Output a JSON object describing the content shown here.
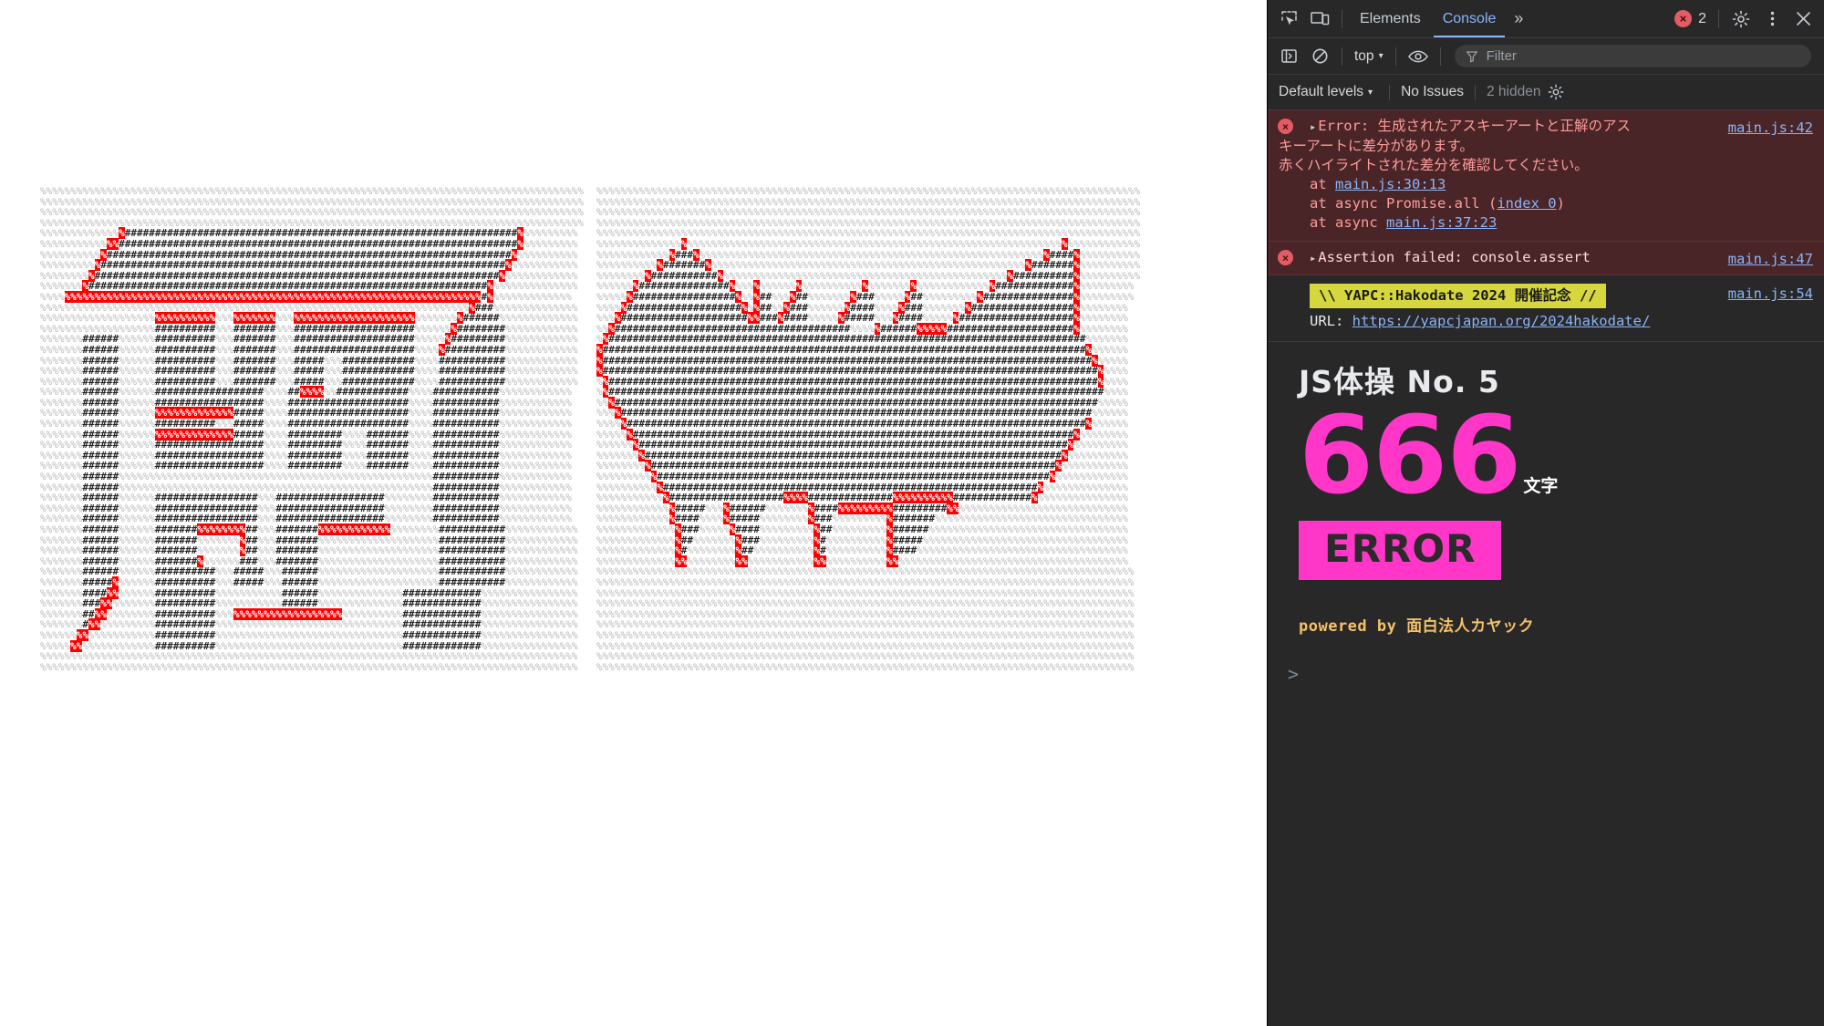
{
  "devtools": {
    "tabbar": {
      "inspect_icon": "inspect-element-icon",
      "device_icon": "device-toolbar-icon",
      "tabs": [
        {
          "label": "Elements",
          "active": false
        },
        {
          "label": "Console",
          "active": true
        }
      ],
      "more_tabs": "»",
      "error_count": "2",
      "error_badge_glyph": "×",
      "settings_icon": "gear-icon",
      "more_icon": "kebab-menu-icon",
      "close_icon": "close-icon"
    },
    "filterbar": {
      "sidebar_icon": "console-sidebar-icon",
      "clear_icon": "clear-console-icon",
      "context_label": "top",
      "context_caret": "▾",
      "eye_icon": "live-expression-icon",
      "filter_icon": "filter-funnel-icon",
      "filter_placeholder": "Filter",
      "filter_value": ""
    },
    "levelsbar": {
      "levels_label": "Default levels",
      "levels_caret": "▾",
      "issues_label": "No Issues",
      "hidden_label": "2 hidden",
      "settings_icon": "console-settings-gear-icon"
    },
    "messages": [
      {
        "type": "error",
        "icon": "error-circle-icon",
        "disclosure": "▸",
        "text_line1": "Error: 生成されたアスキーアートと正解のアス",
        "text_line2": "キーアートに差分があります。",
        "text_line3": "赤くハイライトされた差分を確認してください。",
        "source": "main.js:42",
        "stack": [
          {
            "prefix": "at ",
            "link": "main.js:30:13",
            "suffix": ""
          },
          {
            "prefix": "at async Promise.all (",
            "link": "index 0",
            "suffix": ")"
          },
          {
            "prefix": "at async ",
            "link": "main.js:37:23",
            "suffix": ""
          }
        ]
      },
      {
        "type": "assert",
        "icon": "error-circle-icon",
        "disclosure": "▸",
        "text": "Assertion failed: console.assert",
        "source": "main.js:47"
      },
      {
        "type": "plain",
        "banner": "\\\\ YAPC::Hakodate 2024 開催記念 //",
        "url_label": "URL: ",
        "url": "https://yapcjapan.org/2024hakodate/",
        "source": "main.js:54"
      }
    ],
    "hero": {
      "title": "JS体操 No. 5",
      "count": "666",
      "unit": "文字",
      "badge": "ERROR",
      "powered_by": "powered by 面白法人カヤック"
    },
    "prompt_glyph": ">"
  },
  "colors": {
    "accent_pink": "#ff36c8",
    "banner_yellow": "#d6d63f",
    "error_bg": "#4a2527",
    "link_blue": "#8ab4f8",
    "diff_red": "#ff0000",
    "devtools_bg": "#282828",
    "powered_orange": "#f5c06a"
  },
  "page": {
    "panels": [
      {
        "name": "generated-ascii-art",
        "rows": [
          "%%%%%%%%%%%%%%%%%%%%%%%%%%%%%%%%%%%%%%%%%%%%%%%%%%%%%%%%%%%%%%%%%%%%%%%%%%%%%%%%%%%%%%%%%%",
          "%%%%%%%%%%%%%%%%%%%%%%%%%%%%%%%%%%%%%%%%%%%%%%%%%%%%%%%%%%%%%%%%%%%%%%%%%%%%%%%%%%%%%%%%%%",
          "%%%%%%%%%%%%%%%%%%%%%%%%%%%%%%%%%%%%%%%%%%%%%%%%%%%%%%%%%%%%%%%%%%%%%%%%%%%%%%%%%%%%%%%%%%",
          "%%%%%%%%%%%%%%%%%%%%%%%%%%%%%%%%%%%%%%%%%%%%%%%%%%%%%%%%%%%%%%%%%%%%%%%%%%%%%%%%%%%%%%%%%%",
          "%%%%%%%%%%%%%R#################################################################R%%%%%%%%%",
          "%%%%%%%%%%%RR##################################################################R%%%%%%%%%",
          "%%%%%%%%%%R###################################################################R%%%%%%%%%%",
          "%%%%%%%%%R###################################################################R%%%%%%%%%%%",
          "%%%%%%%%R###################################################################R%%%%%%%%%%%%",
          "%%%%%%%R##################################################################R%%%%%%%%%%%%%%",
          "%%%%RRRRRRRRRRRRRRRRRRRRRRRRRRRRRRRRRRRRRRRRRRRRRRRRRRRRRRRRRRRRRRRRRRRRR#R%%%%%%%%%%%%%",
          "%%%%%%%%%%%%%%%%%%%%%%%%%%%%%%%%%%%%%%%%%%%%%%%%%%%%%%%%%%%%%%%%%%%%%%%R###%%%%%%%%%%%%%%",
          "%%%%%%%%%%%%%%%%%%%RRRRRRRRRR%%%RRRRRRR%%%RRRRRRRRRRRRRRRRRRRR%%%%%%%R######%%%%%%%%%%%%%",
          "%%%%%%%%%%%%%%%%%%%##########%%%#######%%%####################%%%%%%R########%%%%%%%%%%%%",
          "%%%%%%%######%%%%%%##########%%%#######%%%####################%%%%%R#########%%%%%%%%%%%%",
          "%%%%%%%######%%%%%%##########%%%#######%%%####################%%%%R##########%%%%%%%%%%%%",
          "%%%%%%%######%%%%%%##########%%%#######%%%#####%%%############%%%%###########%%%%%%%%%%%%",
          "%%%%%%%######%%%%%%##########%%%#######%%%#####%%%############%%%%###########%%%%%%%%%%%%",
          "%%%%%%%######%%%%%%##########%%%#######%%%#####%%%############%%%%###########%%%%%%%%%%%%",
          "%%%%%%%######%%%%%%##################%%%%##RRRR%%############%%%%###########%%%%%%%%%%%%",
          "%%%%%%%######%%%%%%##################%%%%####################%%%%###########%%%%%%%%%%%%",
          "%%%%%%%######%%%%%%RRRRRRRRRRRRR#####%%%%####################%%%%###########%%%%%%%%%%%%",
          "%%%%%%%######%%%%%%##########%%%#####%%%%####################%%%%###########%%%%%%%%%%%%",
          "%%%%%%%######%%%%%%RRRRRRRRRRRRR#####%%%%#########%%%%#######%%%%###########%%%%%%%%%%%%",
          "%%%%%%%######%%%%%%##################%%%%#########%%%%#######%%%%###########%%%%%%%%%%%%",
          "%%%%%%%######%%%%%%##################%%%%#########%%%%#######%%%%###########%%%%%%%%%%%%",
          "%%%%%%%######%%%%%%##################%%%%#########%%%%#######%%%%###########%%%%%%%%%%%%",
          "%%%%%%%######%%%%%%%%%%%%%%%%%%%%%%%%%%%%%%%%%%%%%%%%%%%%%%%%%%%%###########%%%%%%%%%%%%",
          "%%%%%%%######%%%%%%%%%%%%%%%%%%%%%%%%%%%%%%%%%%%%%%%%%%%%%%%%%%%%###########%%%%%%%%%%%%",
          "%%%%%%%######%%%%%%#################%%%##################%%%%%%%%###########%%%%%%%%%%%%",
          "%%%%%%%######%%%%%%#################%%%##################%%%%%%%%###########%%%%%%%%%%%%",
          "%%%%%%%######%%%%%%#################%%%##################%%%%%%%%###########%%%%%%%%%%%%",
          "%%%%%%%######%%%%%%#######RRRRRRRR##%%%#######RRRRRRRRRRRR%%%%%%%%###########%%%%%%%%%%%%",
          "%%%%%%%######%%%%%%#######%%%%%%%R##%%%#######%%%%%%%%%%%%%%%%%%%%###########%%%%%%%%%%%%",
          "%%%%%%%######%%%%%%#######%%%%%%%R##%%%#######%%%%%%%%%%%%%%%%%%%%###########%%%%%%%%%%%%",
          "%%%%%%%######%%%%%%#######R%%%%%%###%%%#######%%%%%%%%%%%%%%%%%%%%###########%%%%%%%%%%%%",
          "%%%%%%%######%%%%%%##########%%%#####%%%######%%%%%%%%%%%%%%%%%%%%###########%%%%%%%%%%%%",
          "%%%%%%%#####R%%%%%%##########%%%#####%%%######%%%%%%%%%%%%%%%%%%%%###########%%%%%%%%%%%%",
          "%%%%%%%####RR%%%%%%##########%%%%%%%%%%%######%%%%%%%%%%%%%%#############%%%%%%%%%%%%%%%%",
          "%%%%%%%###RR%%%%%%%##########%%%%%%%%%%%######%%%%%%%%%%%%%%#############%%%%%%%%%%%%%%%%",
          "%%%%%%%##RR%%%%%%%%##########%%%RRRRRRRRRRRRRRRRRR%%%%%%%%%%#############%%%%%%%%%%%%%%%%",
          "%%%%%%%#RR%%%%%%%%%##########%%%%%%%%%%%%%%%%%%%%%%%%%%%%%%%#############%%%%%%%%%%%%%%%%",
          "%%%%%%RR%%%%%%%%%%%##########%%%%%%%%%%%%%%%%%%%%%%%%%%%%%%%#############%%%%%%%%%%%%%%%%",
          "%%%%%RR%%%%%%%%%%%%##########%%%%%%%%%%%%%%%%%%%%%%%%%%%%%%%#############%%%%%%%%%%%%%%%%",
          "%%%%%%%%%%%%%%%%%%%%%%%%%%%%%%%%%%%%%%%%%%%%%%%%%%%%%%%%%%%%%%%%%%%%%%%%%%%%%%%%%%%%%%%%%",
          "%%%%%%%%%%%%%%%%%%%%%%%%%%%%%%%%%%%%%%%%%%%%%%%%%%%%%%%%%%%%%%%%%%%%%%%%%%%%%%%%%%%%%%%%%"
        ]
      },
      {
        "name": "expected-ascii-art",
        "rows": [
          "%%%%%%%%%%%%%%%%%%%%%%%%%%%%%%%%%%%%%%%%%%%%%%%%%%%%%%%%%%%%%%%%%%%%%%%%%%%%%%%%%%%%%%%%%%",
          "%%%%%%%%%%%%%%%%%%%%%%%%%%%%%%%%%%%%%%%%%%%%%%%%%%%%%%%%%%%%%%%%%%%%%%%%%%%%%%%%%%%%%%%%%%",
          "%%%%%%%%%%%%%%%%%%%%%%%%%%%%%%%%%%%%%%%%%%%%%%%%%%%%%%%%%%%%%%%%%%%%%%%%%%%%%%%%%%%%%%%%%%",
          "%%%%%%%%%%%%%%%%%%%%%%%%%%%%%%%%%%%%%%%%%%%%%%%%%%%%%%%%%%%%%%%%%%%%%%%%%%%%%%%%%%%%%%%%%%",
          "%%%%%%%%%%%%%%%%%%%%%%%%%%%%%%%%%%%%%%%%%%%%%%%%%%%%%%%%%%%%%%%%%%%%%%%%%%%%%%%%%%%%%%%%%%",
          "%%%%%%%%%%%%%%R%%%%%%%%%%%%%%%%%%%%%%%%%%%%%%%%%%%%%%%%%%%%%%%%%%%%%%%%%%%%%%R%%%%%%%%%%%%",
          "%%%%%%%%%%%%R###R%%%%%%%%%%%%%%%%%%%%%%%%%%%%%%%%%%%%%%%%%%%%%%%%%%%%%%%%%R####R%%%%%%%%%%",
          "%%%%%%%%%%R#######R%%%%%%%%%%%%%%%%%%%%%%%%%%%%%%%%%%%%%%%%%%%%%%%%%%%%R#######R%%%%%%%%%%",
          "%%%%%%%%R###########R%%%%%%%%%%%%%%%%%%%%%%%%%%%%%%%%%%%%%%%%%%%%%%%R##########R%%%%%%%%%%",
          "%%%%%%R###############R%%%R%%%%%%R%%%%%%%%%%R%%%%%%%R%%%%%%%%%%%%R#############R%%%%%%%%%",
          "%%%%%R#################R%%R##%%%R##%%%%%%%R###%%%%%R##%%%%%%%%%R###############R%%%%%%%%%",
          "%%%%R###################R%R##%%R###%%%%%%R####%%%%R###%%%%%%%R#################R%%%%%%%%",
          "%%%R#####################RR###R####%%%%%R#####%%%R####%%%%%R###################R%%%%%%%%",
          "%%R#######################################%%%%R######RRRRR#####################R%%%%%%%%",
          "%R###############################################################################%%%%%%%",
          "R################################################################################R%%%%%%",
          "R#################################################################################R%%%%%",
          "R##################################################################################R%%%%",
          "%R#################################################################################R%%%%",
          "%R##################################################################################%%%%",
          "%%R################################################################################%%%%%",
          "%%%R##############################################################################%%%%%%",
          "%%%%R############################################################################R%%%%%%",
          "%%%%%R#########################################################################R%%%%%%%%",
          "%%%%%%R#######################################################################R%%%%%%%%%",
          "%%%%%%%R#####################################################################R%%%%%%%%%%",
          "%%%%%%%%R###################################################################R%%%%%%%%%%%",
          "%%%%%%%%%R#################################################################R%%%%%%%%%%%%",
          "%%%%%%%%%%R##############################################################R%%%%%%%%%%%%%%",
          "%%%%%%%%%%%R###################RRRR##############RRRRRRRRRR#############R%%%%%%%%%%%%%%%",
          "%%%%%%%%%%%%R#####%%%R######%%%%%%%R####RRRRRRRRR#########RR%%%%%%%%%%%%%%%%%%%%%%%%%%%%",
          "%%%%%%%%%%%%R####%%%%R#####%%%%%%%%R###%%%%%%%%%R#######%%%%%%%%%%%%%%%%%%%%%%%%%%%%%%%%",
          "%%%%%%%%%%%%%R###%%%%%R####%%%%%%%%%R##%%%%%%%%%R######%%%%%%%%%%%%%%%%%%%%%%%%%%%%%%%%%",
          "%%%%%%%%%%%%%R##%%%%%%%R###%%%%%%%%%R#%%%%%%%%%%R#####%%%%%%%%%%%%%%%%%%%%%%%%%%%%%%%%%%",
          "%%%%%%%%%%%%%R#%%%%%%%%R##%%%%%%%%%%R#%%%%%%%%%%R####%%%%%%%%%%%%%%%%%%%%%%%%%%%%%%%%%%%",
          "%%%%%%%%%%%%%RR%%%%%%%%RR%%%%%%%%%%%RR%%%%%%%%%%RR%%%%%%%%%%%%%%%%%%%%%%%%%%%%%%%%%%%%%%",
          "%%%%%%%%%%%%%%%%%%%%%%%%%%%%%%%%%%%%%%%%%%%%%%%%%%%%%%%%%%%%%%%%%%%%%%%%%%%%%%%%%%%%%%%%%",
          "%%%%%%%%%%%%%%%%%%%%%%%%%%%%%%%%%%%%%%%%%%%%%%%%%%%%%%%%%%%%%%%%%%%%%%%%%%%%%%%%%%%%%%%%%",
          "%%%%%%%%%%%%%%%%%%%%%%%%%%%%%%%%%%%%%%%%%%%%%%%%%%%%%%%%%%%%%%%%%%%%%%%%%%%%%%%%%%%%%%%%%",
          "%%%%%%%%%%%%%%%%%%%%%%%%%%%%%%%%%%%%%%%%%%%%%%%%%%%%%%%%%%%%%%%%%%%%%%%%%%%%%%%%%%%%%%%%%",
          "%%%%%%%%%%%%%%%%%%%%%%%%%%%%%%%%%%%%%%%%%%%%%%%%%%%%%%%%%%%%%%%%%%%%%%%%%%%%%%%%%%%%%%%%%",
          "%%%%%%%%%%%%%%%%%%%%%%%%%%%%%%%%%%%%%%%%%%%%%%%%%%%%%%%%%%%%%%%%%%%%%%%%%%%%%%%%%%%%%%%%%",
          "%%%%%%%%%%%%%%%%%%%%%%%%%%%%%%%%%%%%%%%%%%%%%%%%%%%%%%%%%%%%%%%%%%%%%%%%%%%%%%%%%%%%%%%%%",
          "%%%%%%%%%%%%%%%%%%%%%%%%%%%%%%%%%%%%%%%%%%%%%%%%%%%%%%%%%%%%%%%%%%%%%%%%%%%%%%%%%%%%%%%%%",
          "%%%%%%%%%%%%%%%%%%%%%%%%%%%%%%%%%%%%%%%%%%%%%%%%%%%%%%%%%%%%%%%%%%%%%%%%%%%%%%%%%%%%%%%%%",
          "%%%%%%%%%%%%%%%%%%%%%%%%%%%%%%%%%%%%%%%%%%%%%%%%%%%%%%%%%%%%%%%%%%%%%%%%%%%%%%%%%%%%%%%%%"
        ]
      }
    ]
  }
}
